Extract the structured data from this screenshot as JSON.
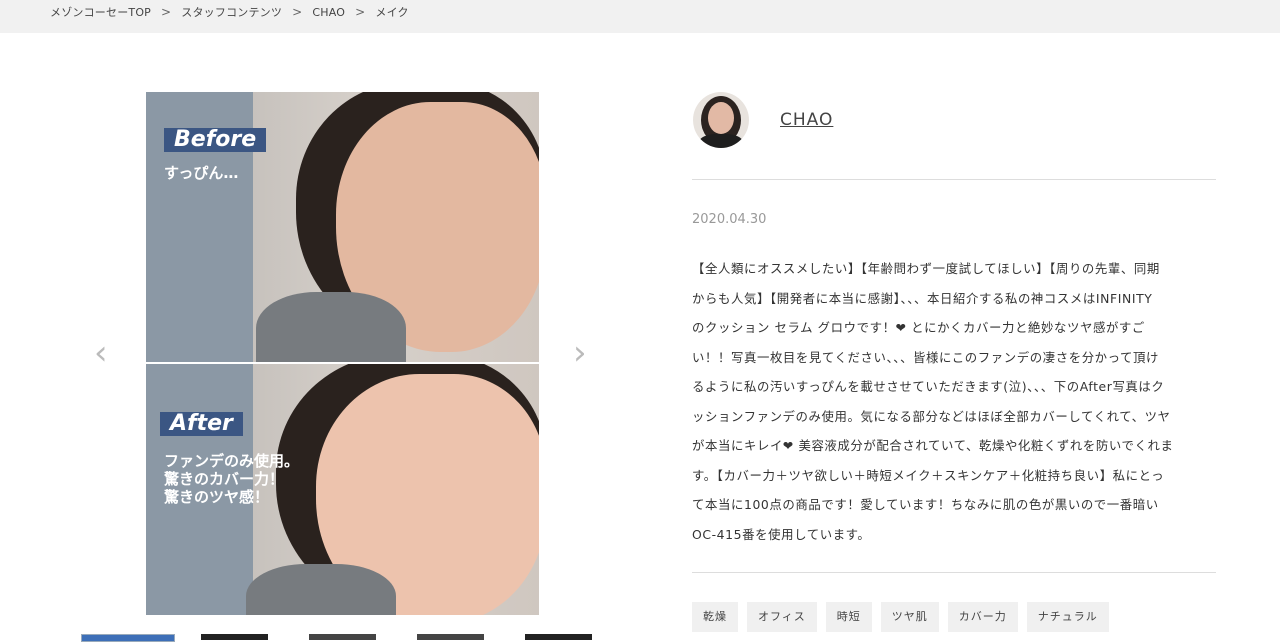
{
  "breadcrumb": {
    "items": [
      "メゾンコーセーTOP",
      "スタッフコンテンツ",
      "CHAO",
      "メイク"
    ],
    "separator": ">"
  },
  "gallery": {
    "before_label": "Before",
    "before_caption": "すっぴん…",
    "after_label": "After",
    "after_caption": "ファンデのみ使用。\n驚きのカバー力！\n驚きのツヤ感！",
    "prev_icon": "‹",
    "next_icon": "›"
  },
  "author": {
    "name": "CHAO"
  },
  "post": {
    "date": "2020.04.30",
    "lines": [
      "【全人類にオススメしたい】【年齢問わず一度試してほしい】【周りの先輩、同期",
      "からも人気】【開発者に本当に感謝】、、、本日紹介する私の神コスメはINFINITY",
      "のクッション セラム グロウです！❤ とにかくカバー力と絶妙なツヤ感がすご",
      "い！！写真一枚目を見てください、、、皆様にこのファンデの凄さを分かって頂け",
      "るように私の汚いすっぴんを載せさせていただきます(泣)、、、下のAfter写真はク",
      "ッションファンデのみ使用。気になる部分などはほぼ全部カバーしてくれて、ツヤ",
      "が本当にキレイ❤ 美容液成分が配合されていて、乾燥や化粧くずれを防いでくれま",
      "す。【カバー力＋ツヤ欲しい＋時短メイク＋スキンケア＋化粧持ち良い】私にとっ",
      "て本当に100点の商品です！愛しています！ちなみに肌の色が黒いので一番暗い",
      "OC-415番を使用しています。"
    ]
  },
  "tags": [
    "乾燥",
    "オフィス",
    "時短",
    "ツヤ肌",
    "カバー力",
    "ナチュラル"
  ],
  "colors": {
    "label_bg": "#3b5683",
    "band": "#8b98a5",
    "crumb_bg": "#f1f1f1"
  }
}
